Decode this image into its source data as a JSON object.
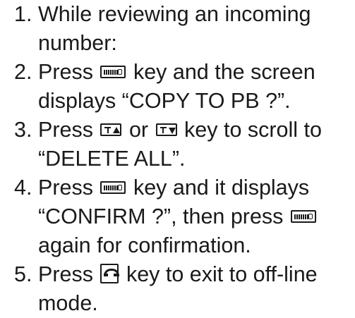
{
  "instructions": {
    "steps": [
      {
        "number": "1.",
        "line1": "While reviewing an incoming",
        "line2": "number:"
      },
      {
        "number": "2.",
        "line1_a": "Press",
        "line1_key": "menu-key-icon",
        "line1_b": "key and the screen",
        "line2": "displays “COPY TO PB ?”."
      },
      {
        "number": "3.",
        "line1_a": "Press",
        "line1_key1": "scroll-up-key-icon",
        "line1_b": "or",
        "line1_key2": "scroll-down-key-icon",
        "line1_c": "key to scroll to",
        "line2": "“DELETE ALL”."
      },
      {
        "number": "4.",
        "line1_a": "Press",
        "line1_key": "menu-key-icon",
        "line1_b": "key and it displays",
        "line2_a": "“CONFIRM ?”, then press",
        "line2_key": "menu-key-icon",
        "line3": "again for confirmation."
      },
      {
        "number": "5.",
        "line1_a": "Press",
        "line1_key": "end-call-key-icon",
        "line1_b": "key to exit to off-line",
        "line2": "mode."
      }
    ]
  }
}
